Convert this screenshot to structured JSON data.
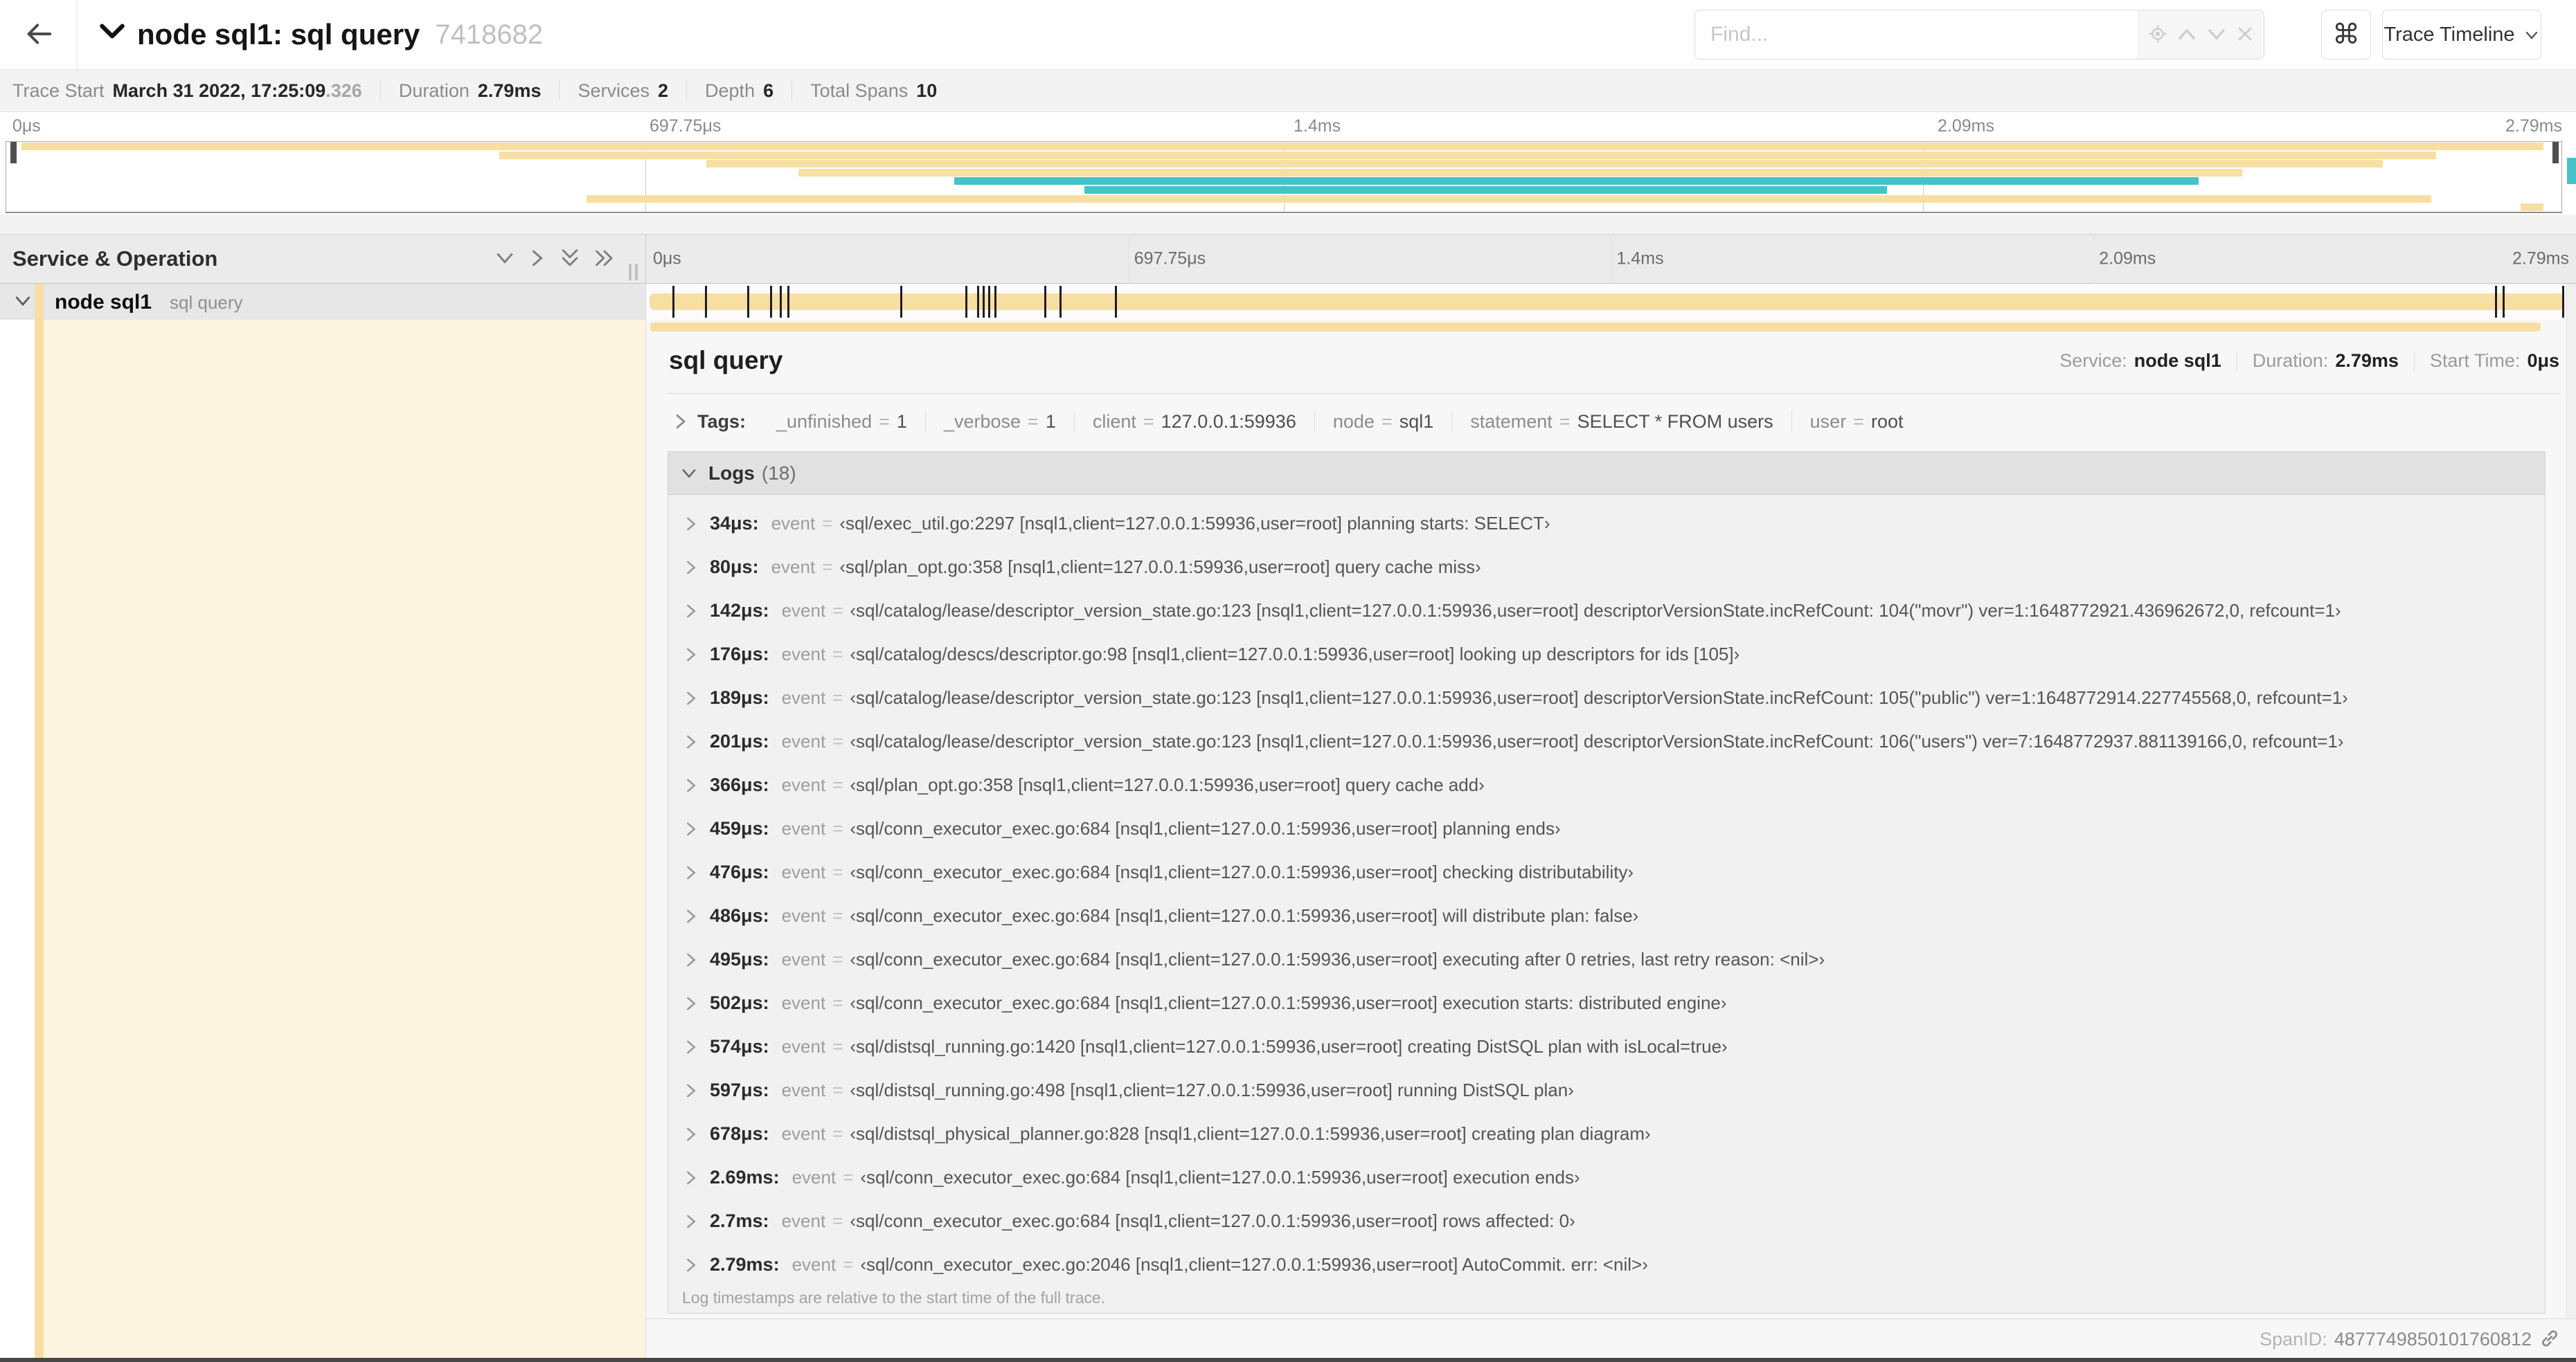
{
  "header": {
    "title": "node sql1: sql query",
    "trace_id": "7418682",
    "find_placeholder": "Find...",
    "shortcut_button": "⌘",
    "view_selector": "Trace Timeline"
  },
  "infobar": {
    "items": [
      {
        "label": "Trace Start",
        "value": "March 31 2022, 17:25:09",
        "suffix": ".326"
      },
      {
        "label": "Duration",
        "value": "2.79ms"
      },
      {
        "label": "Services",
        "value": "2"
      },
      {
        "label": "Depth",
        "value": "6"
      },
      {
        "label": "Total Spans",
        "value": "10"
      }
    ]
  },
  "minimap": {
    "tick_labels": [
      "0μs",
      "697.75μs",
      "1.4ms",
      "2.09ms",
      "2.79ms"
    ],
    "bars": [
      {
        "row": 0,
        "color": "tan",
        "x1": 0.006,
        "x2": 0.993
      },
      {
        "row": 1,
        "color": "tan",
        "x1": 0.193,
        "x2": 0.951
      },
      {
        "row": 2,
        "color": "tan",
        "x1": 0.274,
        "x2": 0.93
      },
      {
        "row": 3,
        "color": "tan",
        "x1": 0.31,
        "x2": 0.875
      },
      {
        "row": 4,
        "color": "teal",
        "x1": 0.371,
        "x2": 0.858
      },
      {
        "row": 5,
        "color": "teal",
        "x1": 0.422,
        "x2": 0.736
      },
      {
        "row": 6,
        "color": "tan",
        "x1": 0.227,
        "x2": 0.949
      },
      {
        "row": 7,
        "color": "tan",
        "x1": 0.984,
        "x2": 0.993
      }
    ]
  },
  "columns": {
    "left_header": "Service & Operation",
    "ruler_tick_labels": [
      "0μs",
      "697.75μs",
      "1.4ms",
      "2.09ms",
      "2.79ms"
    ]
  },
  "span_row": {
    "service": "node sql1",
    "operation": "sql query",
    "log_marker_positions": [
      0.012,
      0.029,
      0.051,
      0.063,
      0.068,
      0.072,
      0.131,
      0.165,
      0.171,
      0.174,
      0.177,
      0.18,
      0.206,
      0.214,
      0.243,
      0.964,
      0.968,
      0.999
    ]
  },
  "detail": {
    "title": "sql query",
    "overview": [
      {
        "label": "Service:",
        "value": "node sql1"
      },
      {
        "label": "Duration:",
        "value": "2.79ms"
      },
      {
        "label": "Start Time:",
        "value": "0μs"
      }
    ],
    "tags": {
      "label": "Tags:",
      "equals": "=",
      "items": [
        {
          "key": "_unfinished",
          "value": "1"
        },
        {
          "key": "_verbose",
          "value": "1"
        },
        {
          "key": "client",
          "value": "127.0.0.1:59936"
        },
        {
          "key": "node",
          "value": "sql1"
        },
        {
          "key": "statement",
          "value": "SELECT * FROM users"
        },
        {
          "key": "user",
          "value": "root"
        }
      ]
    },
    "logs": {
      "label": "Logs",
      "count": "(18)",
      "field": "event",
      "equals": "=",
      "entries": [
        {
          "time": "34μs:",
          "value": "‹sql/exec_util.go:2297 [nsql1,client=127.0.0.1:59936,user=root] planning starts: SELECT›"
        },
        {
          "time": "80μs:",
          "value": "‹sql/plan_opt.go:358 [nsql1,client=127.0.0.1:59936,user=root] query cache miss›"
        },
        {
          "time": "142μs:",
          "value": "‹sql/catalog/lease/descriptor_version_state.go:123 [nsql1,client=127.0.0.1:59936,user=root] descriptorVersionState.incRefCount: 104(\"movr\") ver=1:1648772921.436962672,0, refcount=1›"
        },
        {
          "time": "176μs:",
          "value": "‹sql/catalog/descs/descriptor.go:98 [nsql1,client=127.0.0.1:59936,user=root] looking up descriptors for ids [105]›"
        },
        {
          "time": "189μs:",
          "value": "‹sql/catalog/lease/descriptor_version_state.go:123 [nsql1,client=127.0.0.1:59936,user=root] descriptorVersionState.incRefCount: 105(\"public\") ver=1:1648772914.227745568,0, refcount=1›"
        },
        {
          "time": "201μs:",
          "value": "‹sql/catalog/lease/descriptor_version_state.go:123 [nsql1,client=127.0.0.1:59936,user=root] descriptorVersionState.incRefCount: 106(\"users\") ver=7:1648772937.881139166,0, refcount=1›"
        },
        {
          "time": "366μs:",
          "value": "‹sql/plan_opt.go:358 [nsql1,client=127.0.0.1:59936,user=root] query cache add›"
        },
        {
          "time": "459μs:",
          "value": "‹sql/conn_executor_exec.go:684 [nsql1,client=127.0.0.1:59936,user=root] planning ends›"
        },
        {
          "time": "476μs:",
          "value": "‹sql/conn_executor_exec.go:684 [nsql1,client=127.0.0.1:59936,user=root] checking distributability›"
        },
        {
          "time": "486μs:",
          "value": "‹sql/conn_executor_exec.go:684 [nsql1,client=127.0.0.1:59936,user=root] will distribute plan: false›"
        },
        {
          "time": "495μs:",
          "value": "‹sql/conn_executor_exec.go:684 [nsql1,client=127.0.0.1:59936,user=root] executing after 0 retries, last retry reason: <nil>›"
        },
        {
          "time": "502μs:",
          "value": "‹sql/conn_executor_exec.go:684 [nsql1,client=127.0.0.1:59936,user=root] execution starts: distributed engine›"
        },
        {
          "time": "574μs:",
          "value": "‹sql/distsql_running.go:1420 [nsql1,client=127.0.0.1:59936,user=root] creating DistSQL plan with isLocal=true›"
        },
        {
          "time": "597μs:",
          "value": "‹sql/distsql_running.go:498 [nsql1,client=127.0.0.1:59936,user=root] running DistSQL plan›"
        },
        {
          "time": "678μs:",
          "value": "‹sql/distsql_physical_planner.go:828 [nsql1,client=127.0.0.1:59936,user=root] creating plan diagram›"
        },
        {
          "time": "2.69ms:",
          "value": "‹sql/conn_executor_exec.go:684 [nsql1,client=127.0.0.1:59936,user=root] execution ends›"
        },
        {
          "time": "2.7ms:",
          "value": "‹sql/conn_executor_exec.go:684 [nsql1,client=127.0.0.1:59936,user=root] rows affected: 0›"
        },
        {
          "time": "2.79ms:",
          "value": "‹sql/conn_executor_exec.go:2046 [nsql1,client=127.0.0.1:59936,user=root] AutoCommit. err: <nil>›"
        }
      ],
      "note": "Log timestamps are relative to the start time of the full trace."
    },
    "footer": {
      "label": "SpanID:",
      "value": "4877749850101760812"
    }
  },
  "colors": {
    "span": "#f7dfa3",
    "span_light": "#fcf4e1",
    "teal": "#46c3c8",
    "selected_row": "#e7e7e7"
  }
}
